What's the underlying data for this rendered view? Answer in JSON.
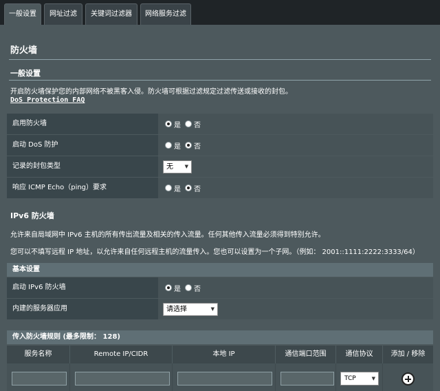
{
  "tabs": [
    {
      "label": "一般设置",
      "active": true
    },
    {
      "label": "网址过滤",
      "active": false
    },
    {
      "label": "关键词过滤器",
      "active": false
    },
    {
      "label": "网络服务过滤",
      "active": false
    }
  ],
  "page_title": "防火墙",
  "general": {
    "heading": "一般设置",
    "description": "开启防火墙保护您的内部网络不被黑客入侵。防火墙可根据过滤规定过滤传送或接收的封包。",
    "faq_link": "DoS Protection FAQ",
    "rows": [
      {
        "label": "启用防火墙",
        "yes": "是",
        "no": "否",
        "value": "yes"
      },
      {
        "label": "启动 DoS 防护",
        "yes": "是",
        "no": "否",
        "value": "no"
      },
      {
        "label": "记录的封包类型",
        "select_value": "无"
      },
      {
        "label": "响应 ICMP Echo（ping）要求",
        "yes": "是",
        "no": "否",
        "value": "no"
      }
    ]
  },
  "ipv6": {
    "heading": "IPv6 防火墙",
    "desc1": "允许来自局域网中 IPv6 主机的所有传出流量及相关的传入流量。任何其他传入流量必须得到特别允许。",
    "desc2": "您可以不填写远程 IP 地址，以允许来自任何远程主机的流量传入。您也可以设置为一个子网。（例如： 2001::1111:2222:3333/64）",
    "basic_bar": "基本设置",
    "enable_label": "启动 IPv6 防火墙",
    "enable_yes": "是",
    "enable_no": "否",
    "enable_value": "yes",
    "builtin_label": "内建的服务器应用",
    "builtin_select": "请选择",
    "rules_bar": "传入防火墙规则 (最多限制： 128)",
    "columns": [
      "服务名称",
      "Remote IP/CIDR",
      "本地 IP",
      "通信端口范围",
      "通信协议",
      "添加 / 移除"
    ],
    "protocol_value": "TCP"
  },
  "icons": {
    "radio": "radio-icon",
    "dropdown": "chevron-down-icon",
    "add": "add-circle-icon"
  }
}
